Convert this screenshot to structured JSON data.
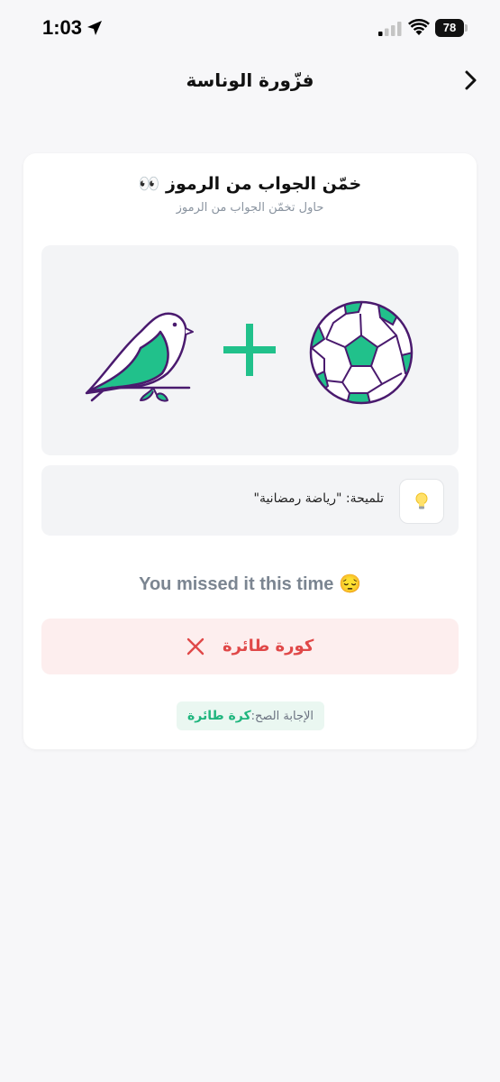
{
  "status_bar": {
    "time": "1:03",
    "battery": "78"
  },
  "header": {
    "title": "فزّورة الوناسة"
  },
  "card": {
    "title": "خمّن الجواب من الرموز 👀",
    "subtitle": "حاول تخمّن الجواب من الرموز"
  },
  "puzzle": {
    "symbols": [
      "bird-image",
      "plus-icon",
      "soccer-ball-image"
    ]
  },
  "hint": {
    "text": "تلميحة: \"رياضة رمضانية\""
  },
  "result": {
    "message": "You missed it this time 😔"
  },
  "answer": {
    "user_answer": "كورة طائرة"
  },
  "correct": {
    "label": "الإجابة الصح:",
    "value": "كرة طائرة"
  },
  "colors": {
    "accent_green": "#21c18b",
    "outline_purple": "#4a1a6e",
    "error_red": "#e04848",
    "error_bg": "#fdeeee"
  }
}
